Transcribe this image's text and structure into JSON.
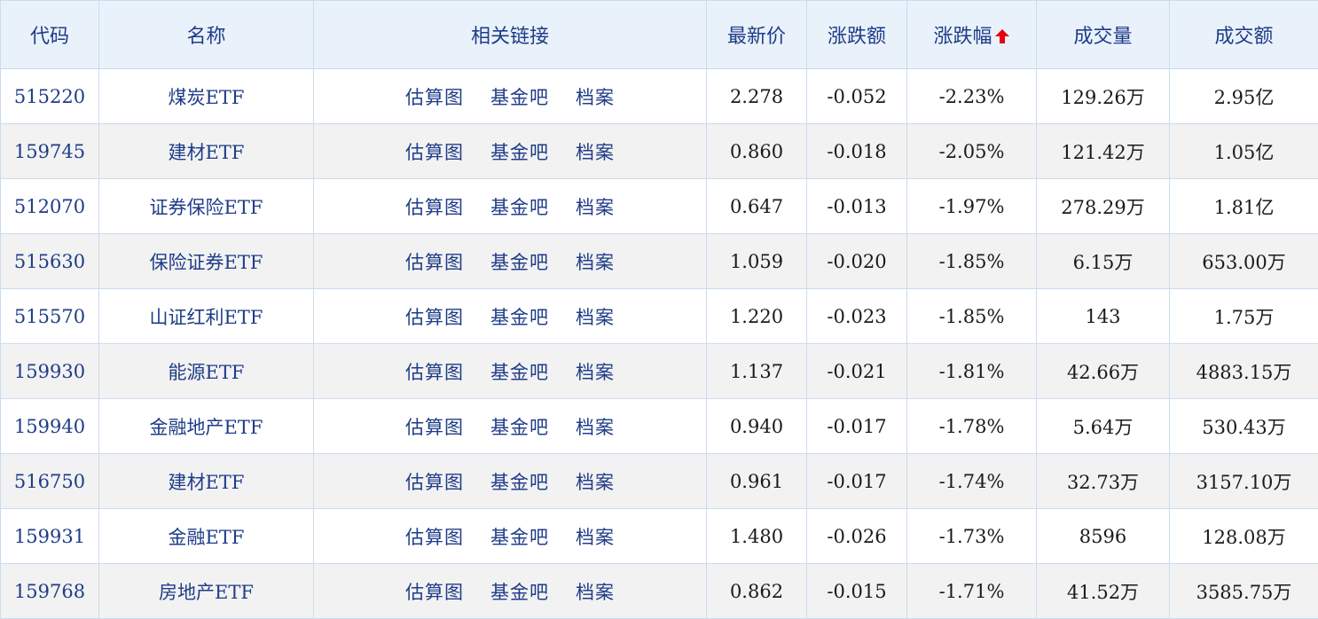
{
  "columns": {
    "code": "代码",
    "name": "名称",
    "links": "相关链接",
    "price": "最新价",
    "change": "涨跌额",
    "pct": "涨跌幅",
    "volume": "成交量",
    "amount": "成交额"
  },
  "sort": {
    "column": "pct",
    "arrow_color": "#e60012",
    "icon": "sort-up-arrow-icon"
  },
  "colors": {
    "header_bg": "#e9f2fb",
    "link": "#1f3c88",
    "down": "#119911",
    "border": "#c9dcef"
  },
  "rows": [
    {
      "code": "515220",
      "name": "煤炭ETF",
      "links": [
        "估算图",
        "基金吧",
        "档案"
      ],
      "price": "2.278",
      "change": "-0.052",
      "pct": "-2.23%",
      "volume": "129.26万",
      "amount": "2.95亿"
    },
    {
      "code": "159745",
      "name": "建材ETF",
      "links": [
        "估算图",
        "基金吧",
        "档案"
      ],
      "price": "0.860",
      "change": "-0.018",
      "pct": "-2.05%",
      "volume": "121.42万",
      "amount": "1.05亿"
    },
    {
      "code": "512070",
      "name": "证券保险ETF",
      "links": [
        "估算图",
        "基金吧",
        "档案"
      ],
      "price": "0.647",
      "change": "-0.013",
      "pct": "-1.97%",
      "volume": "278.29万",
      "amount": "1.81亿"
    },
    {
      "code": "515630",
      "name": "保险证券ETF",
      "links": [
        "估算图",
        "基金吧",
        "档案"
      ],
      "price": "1.059",
      "change": "-0.020",
      "pct": "-1.85%",
      "volume": "6.15万",
      "amount": "653.00万"
    },
    {
      "code": "515570",
      "name": "山证红利ETF",
      "links": [
        "估算图",
        "基金吧",
        "档案"
      ],
      "price": "1.220",
      "change": "-0.023",
      "pct": "-1.85%",
      "volume": "143",
      "amount": "1.75万"
    },
    {
      "code": "159930",
      "name": "能源ETF",
      "links": [
        "估算图",
        "基金吧",
        "档案"
      ],
      "price": "1.137",
      "change": "-0.021",
      "pct": "-1.81%",
      "volume": "42.66万",
      "amount": "4883.15万"
    },
    {
      "code": "159940",
      "name": "金融地产ETF",
      "links": [
        "估算图",
        "基金吧",
        "档案"
      ],
      "price": "0.940",
      "change": "-0.017",
      "pct": "-1.78%",
      "volume": "5.64万",
      "amount": "530.43万"
    },
    {
      "code": "516750",
      "name": "建材ETF",
      "links": [
        "估算图",
        "基金吧",
        "档案"
      ],
      "price": "0.961",
      "change": "-0.017",
      "pct": "-1.74%",
      "volume": "32.73万",
      "amount": "3157.10万"
    },
    {
      "code": "159931",
      "name": "金融ETF",
      "links": [
        "估算图",
        "基金吧",
        "档案"
      ],
      "price": "1.480",
      "change": "-0.026",
      "pct": "-1.73%",
      "volume": "8596",
      "amount": "128.08万"
    },
    {
      "code": "159768",
      "name": "房地产ETF",
      "links": [
        "估算图",
        "基金吧",
        "档案"
      ],
      "price": "0.862",
      "change": "-0.015",
      "pct": "-1.71%",
      "volume": "41.52万",
      "amount": "3585.75万"
    }
  ]
}
